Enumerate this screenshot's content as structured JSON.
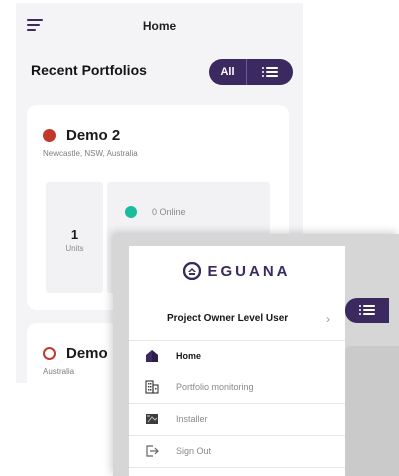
{
  "colors": {
    "brand_purple": "#3a2a5f",
    "status_offline_red": "#c0392b",
    "status_online_teal": "#1abc9c",
    "background": "#f4f4f6"
  },
  "home": {
    "header": {
      "menu_icon": "hamburger-icon",
      "title": "Home"
    },
    "section_title": "Recent Portfolios",
    "filter": {
      "all_label": "All",
      "list_icon": "list-view-icon"
    },
    "portfolios": [
      {
        "name": "Demo 2",
        "location": "Newcastle, NSW, Australia",
        "status_icon": "filled-dot-icon",
        "units_count": "1",
        "units_label": "Units",
        "online_label": "0 Online"
      },
      {
        "name": "Demo",
        "location": "Australia",
        "status_icon": "ring-dot-icon"
      }
    ]
  },
  "drawer": {
    "brand": {
      "logo_icon": "eguana-logo-icon",
      "name": "EGUANA"
    },
    "user": {
      "name": "Project Owner Level User",
      "chevron": "›"
    },
    "menu": [
      {
        "label": "Home",
        "icon": "home-icon",
        "active": true
      },
      {
        "label": "Portfolio monitoring",
        "icon": "building-icon",
        "active": false
      },
      {
        "label": "Installer",
        "icon": "installer-icon",
        "active": false
      },
      {
        "label": "Sign Out",
        "icon": "sign-out-icon",
        "active": false
      }
    ]
  }
}
